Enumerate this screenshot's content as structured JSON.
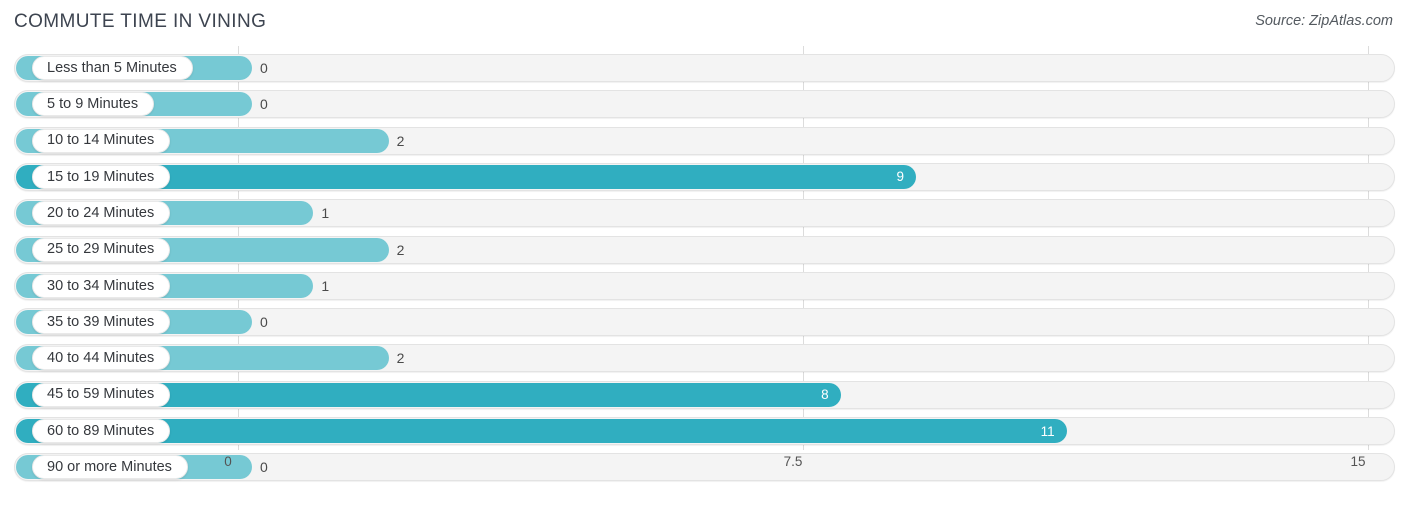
{
  "header": {
    "title": "COMMUTE TIME IN VINING",
    "source": "Source: ZipAtlas.com"
  },
  "colors": {
    "bar_light": "#76c9d4",
    "bar_dark": "#30aec0",
    "track": "#f4f4f4",
    "gridline": "#dcdcdc",
    "title_text": "#3d4450"
  },
  "chart_data": {
    "type": "bar",
    "orientation": "horizontal",
    "title": "COMMUTE TIME IN VINING",
    "xlabel": "",
    "ylabel": "",
    "xlim": [
      0,
      15
    ],
    "xticks": [
      "0",
      "7.5",
      "15"
    ],
    "xtick_values": [
      0,
      7.5,
      15
    ],
    "grid": true,
    "legend": false,
    "categories": [
      "Less than 5 Minutes",
      "5 to 9 Minutes",
      "10 to 14 Minutes",
      "15 to 19 Minutes",
      "20 to 24 Minutes",
      "25 to 29 Minutes",
      "30 to 34 Minutes",
      "35 to 39 Minutes",
      "40 to 44 Minutes",
      "45 to 59 Minutes",
      "60 to 89 Minutes",
      "90 or more Minutes"
    ],
    "values": [
      0,
      0,
      2,
      9,
      1,
      2,
      1,
      0,
      2,
      8,
      11,
      0
    ],
    "value_labels": [
      "0",
      "0",
      "2",
      "9",
      "1",
      "2",
      "1",
      "0",
      "2",
      "8",
      "11",
      "0"
    ]
  },
  "rows": [
    {
      "label": "Less than 5 Minutes",
      "value": 0,
      "value_label": "0",
      "shade": "light",
      "label_inside": true
    },
    {
      "label": "5 to 9 Minutes",
      "value": 0,
      "value_label": "0",
      "shade": "light",
      "label_inside": true
    },
    {
      "label": "10 to 14 Minutes",
      "value": 2,
      "value_label": "2",
      "shade": "light",
      "label_inside": true
    },
    {
      "label": "15 to 19 Minutes",
      "value": 9,
      "value_label": "9",
      "shade": "dark",
      "label_inside": true
    },
    {
      "label": "20 to 24 Minutes",
      "value": 1,
      "value_label": "1",
      "shade": "light",
      "label_inside": true
    },
    {
      "label": "25 to 29 Minutes",
      "value": 2,
      "value_label": "2",
      "shade": "light",
      "label_inside": true
    },
    {
      "label": "30 to 34 Minutes",
      "value": 1,
      "value_label": "1",
      "shade": "light",
      "label_inside": true
    },
    {
      "label": "35 to 39 Minutes",
      "value": 0,
      "value_label": "0",
      "shade": "light",
      "label_inside": true
    },
    {
      "label": "40 to 44 Minutes",
      "value": 2,
      "value_label": "2",
      "shade": "light",
      "label_inside": true
    },
    {
      "label": "45 to 59 Minutes",
      "value": 8,
      "value_label": "8",
      "shade": "dark",
      "label_inside": true
    },
    {
      "label": "60 to 89 Minutes",
      "value": 11,
      "value_label": "11",
      "shade": "dark",
      "label_inside": true
    },
    {
      "label": "90 or more Minutes",
      "value": 0,
      "value_label": "0",
      "shade": "light",
      "label_inside": true
    }
  ],
  "axis": {
    "ticks": [
      "0",
      "7.5",
      "15"
    ]
  }
}
